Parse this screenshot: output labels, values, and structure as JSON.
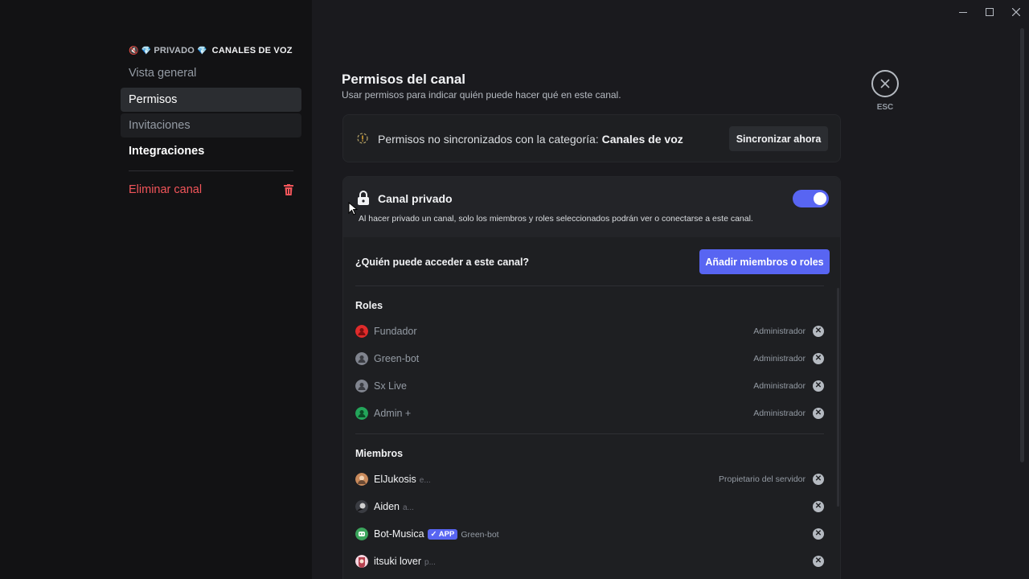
{
  "sidebar": {
    "header_prefix": "PRIVADO",
    "header_channel": "CANALES DE VOZ",
    "items": [
      {
        "label": "Vista general"
      },
      {
        "label": "Permisos"
      },
      {
        "label": "Invitaciones"
      },
      {
        "label": "Integraciones"
      }
    ],
    "delete_label": "Eliminar canal"
  },
  "page": {
    "title": "Permisos del canal",
    "subtitle": "Usar permisos para indicar quién puede hacer qué en este canal.",
    "esc_label": "ESC"
  },
  "sync": {
    "text": "Permisos no sincronizados con la categoría:",
    "category": "Canales de voz",
    "button": "Sincronizar ahora"
  },
  "private": {
    "title": "Canal privado",
    "description": "Al hacer privado un canal, solo los miembros y roles seleccionados podrán ver o conectarse a este canal.",
    "enabled": true,
    "who_label": "¿Quién puede acceder a este canal?",
    "add_button": "Añadir miembros o roles",
    "roles_label": "Roles",
    "roles": [
      {
        "name": "Fundador",
        "tag": "Administrador",
        "color": "#e02b2b"
      },
      {
        "name": "Green-bot",
        "tag": "Administrador",
        "color": "#80848e"
      },
      {
        "name": "Sx Live",
        "tag": "Administrador",
        "color": "#80848e"
      },
      {
        "name": "Admin +",
        "tag": "Administrador",
        "color": "#23a55a"
      }
    ],
    "members_label": "Miembros",
    "members": [
      {
        "name": "ElJukosis",
        "sub": "e...",
        "tag": "Propietario del servidor"
      },
      {
        "name": "Aiden",
        "sub": "a...",
        "tag": ""
      },
      {
        "name": "Bot-Musica",
        "badge": "APP",
        "role": "Green-bot",
        "tag": ""
      },
      {
        "name": "itsuki lover",
        "sub": "p...",
        "tag": ""
      }
    ]
  },
  "colors": {
    "accent": "#5865f2",
    "danger": "#f2555a"
  }
}
